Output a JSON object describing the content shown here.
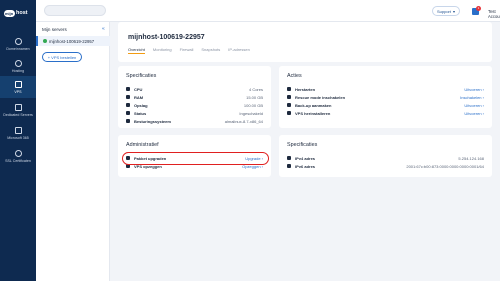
{
  "brand": {
    "logo_mark": "mijn",
    "logo_text": "host"
  },
  "nav": [
    {
      "label": "Domeinnamen",
      "icon": "globe-icon"
    },
    {
      "label": "Hosting",
      "icon": "cloud-icon"
    },
    {
      "label": "VPS",
      "icon": "server-icon",
      "active": true
    },
    {
      "label": "Dedicated Servers",
      "icon": "rack-icon"
    },
    {
      "label": "Microsoft 365",
      "icon": "windows-icon"
    },
    {
      "label": "SSL Certificaten",
      "icon": "shield-icon"
    }
  ],
  "topbar": {
    "search_placeholder": "",
    "support_label": "Support",
    "cart_count": "1",
    "account_name": "Test Account",
    "avatar_initials": "TA"
  },
  "servers": {
    "title": "Mijn servers",
    "items": [
      {
        "name": "mijnhost-100619-22957"
      }
    ],
    "order_label": "+ VPS bestellen"
  },
  "header": {
    "title": "mijnhost-100619-22957",
    "tabs": [
      "Overzicht",
      "Monitoring",
      "Firewall",
      "Snapshots",
      "IP-adressen"
    ]
  },
  "specs": {
    "title": "Specificaties",
    "rows": [
      {
        "label": "CPU",
        "value": "4 Cores"
      },
      {
        "label": "RAM",
        "value": "15.00 GB"
      },
      {
        "label": "Opslag",
        "value": "100.00 GB"
      },
      {
        "label": "Status",
        "value": "Ingeschakeld"
      },
      {
        "label": "Besturingssysteem",
        "value": "almalinux-8.7-x86_64"
      }
    ]
  },
  "actions": {
    "title": "Acties",
    "rows": [
      {
        "label": "Herstarten",
        "action": "Uitvoeren"
      },
      {
        "label": "Rescue mode inschakelen",
        "action": "Inschakelen"
      },
      {
        "label": "Back-up aanmaken",
        "action": "Uitvoeren"
      },
      {
        "label": "VPS herinstalleren",
        "action": "Uitvoeren"
      }
    ]
  },
  "admin": {
    "title": "Administratief",
    "rows": [
      {
        "label": "Pakket upgraden",
        "action": "Upgrade"
      },
      {
        "label": "VPS opzeggen",
        "action": "Opzeggen"
      }
    ]
  },
  "network": {
    "title": "Specificaties",
    "rows": [
      {
        "label": "IPv4 adres",
        "value": "5.254.124.168"
      },
      {
        "label": "IPv6 adres",
        "value": "2001:67c:b00:873:0000:0000:0000:0001/64"
      }
    ]
  }
}
